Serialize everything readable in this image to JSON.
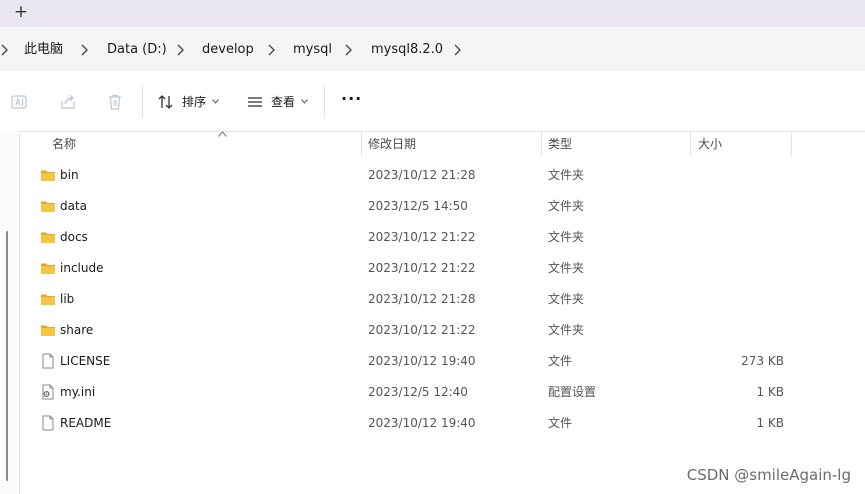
{
  "tabbar": {
    "new_tab_symbol": "+"
  },
  "breadcrumb": [
    "此电脑",
    "Data (D:)",
    "develop",
    "mysql",
    "mysql8.2.0"
  ],
  "toolbar": {
    "sort_label": "排序",
    "view_label": "查看",
    "more_label": "···"
  },
  "columns": {
    "name": "名称",
    "date": "修改日期",
    "type": "类型",
    "size": "大小"
  },
  "files": [
    {
      "name": "bin",
      "date": "2023/10/12 21:28",
      "type": "文件夹",
      "size": "",
      "icon": "folder-icon"
    },
    {
      "name": "data",
      "date": "2023/12/5 14:50",
      "type": "文件夹",
      "size": "",
      "icon": "folder-icon"
    },
    {
      "name": "docs",
      "date": "2023/10/12 21:22",
      "type": "文件夹",
      "size": "",
      "icon": "folder-icon"
    },
    {
      "name": "include",
      "date": "2023/10/12 21:22",
      "type": "文件夹",
      "size": "",
      "icon": "folder-icon"
    },
    {
      "name": "lib",
      "date": "2023/10/12 21:28",
      "type": "文件夹",
      "size": "",
      "icon": "folder-icon"
    },
    {
      "name": "share",
      "date": "2023/10/12 21:22",
      "type": "文件夹",
      "size": "",
      "icon": "folder-icon"
    },
    {
      "name": "LICENSE",
      "date": "2023/10/12 19:40",
      "type": "文件",
      "size": "273 KB",
      "icon": "file-icon"
    },
    {
      "name": "my.ini",
      "date": "2023/12/5 12:40",
      "type": "配置设置",
      "size": "1 KB",
      "icon": "settings-file-icon"
    },
    {
      "name": "README",
      "date": "2023/10/12 19:40",
      "type": "文件",
      "size": "1 KB",
      "icon": "file-icon"
    }
  ],
  "watermark": "CSDN @smileAgain-lg",
  "colors": {
    "tabbar_bg": "#e9e6f1",
    "address_bg": "#f5f5f5",
    "folder_yellow": "#f4c542",
    "folder_dark": "#e0a82e"
  }
}
